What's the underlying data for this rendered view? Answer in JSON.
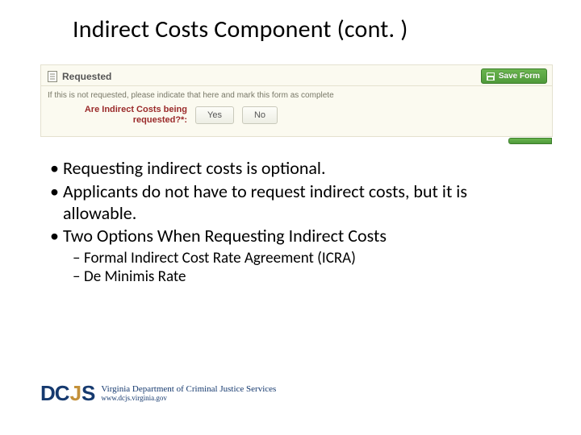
{
  "title": "Indirect Costs Component (cont. )",
  "form": {
    "section_title": "Requested",
    "note": "If this is not requested, please indicate that here and mark this form as complete",
    "question": "Are Indirect Costs being requested?*:",
    "yes_label": "Yes",
    "no_label": "No",
    "save_label": "Save Form"
  },
  "bullets": [
    "Requesting indirect costs is optional.",
    "Applicants do not have to request indirect costs, but it is allowable.",
    "Two Options When Requesting Indirect Costs"
  ],
  "sub_bullets": [
    "Formal Indirect Cost Rate Agreement (ICRA)",
    "De Minimis Rate"
  ],
  "footer": {
    "acronym_parts": [
      "D",
      "C",
      "J",
      "S"
    ],
    "org_name": "Virginia Department of Criminal Justice Services",
    "url": "www.dcjs.virginia.gov"
  }
}
